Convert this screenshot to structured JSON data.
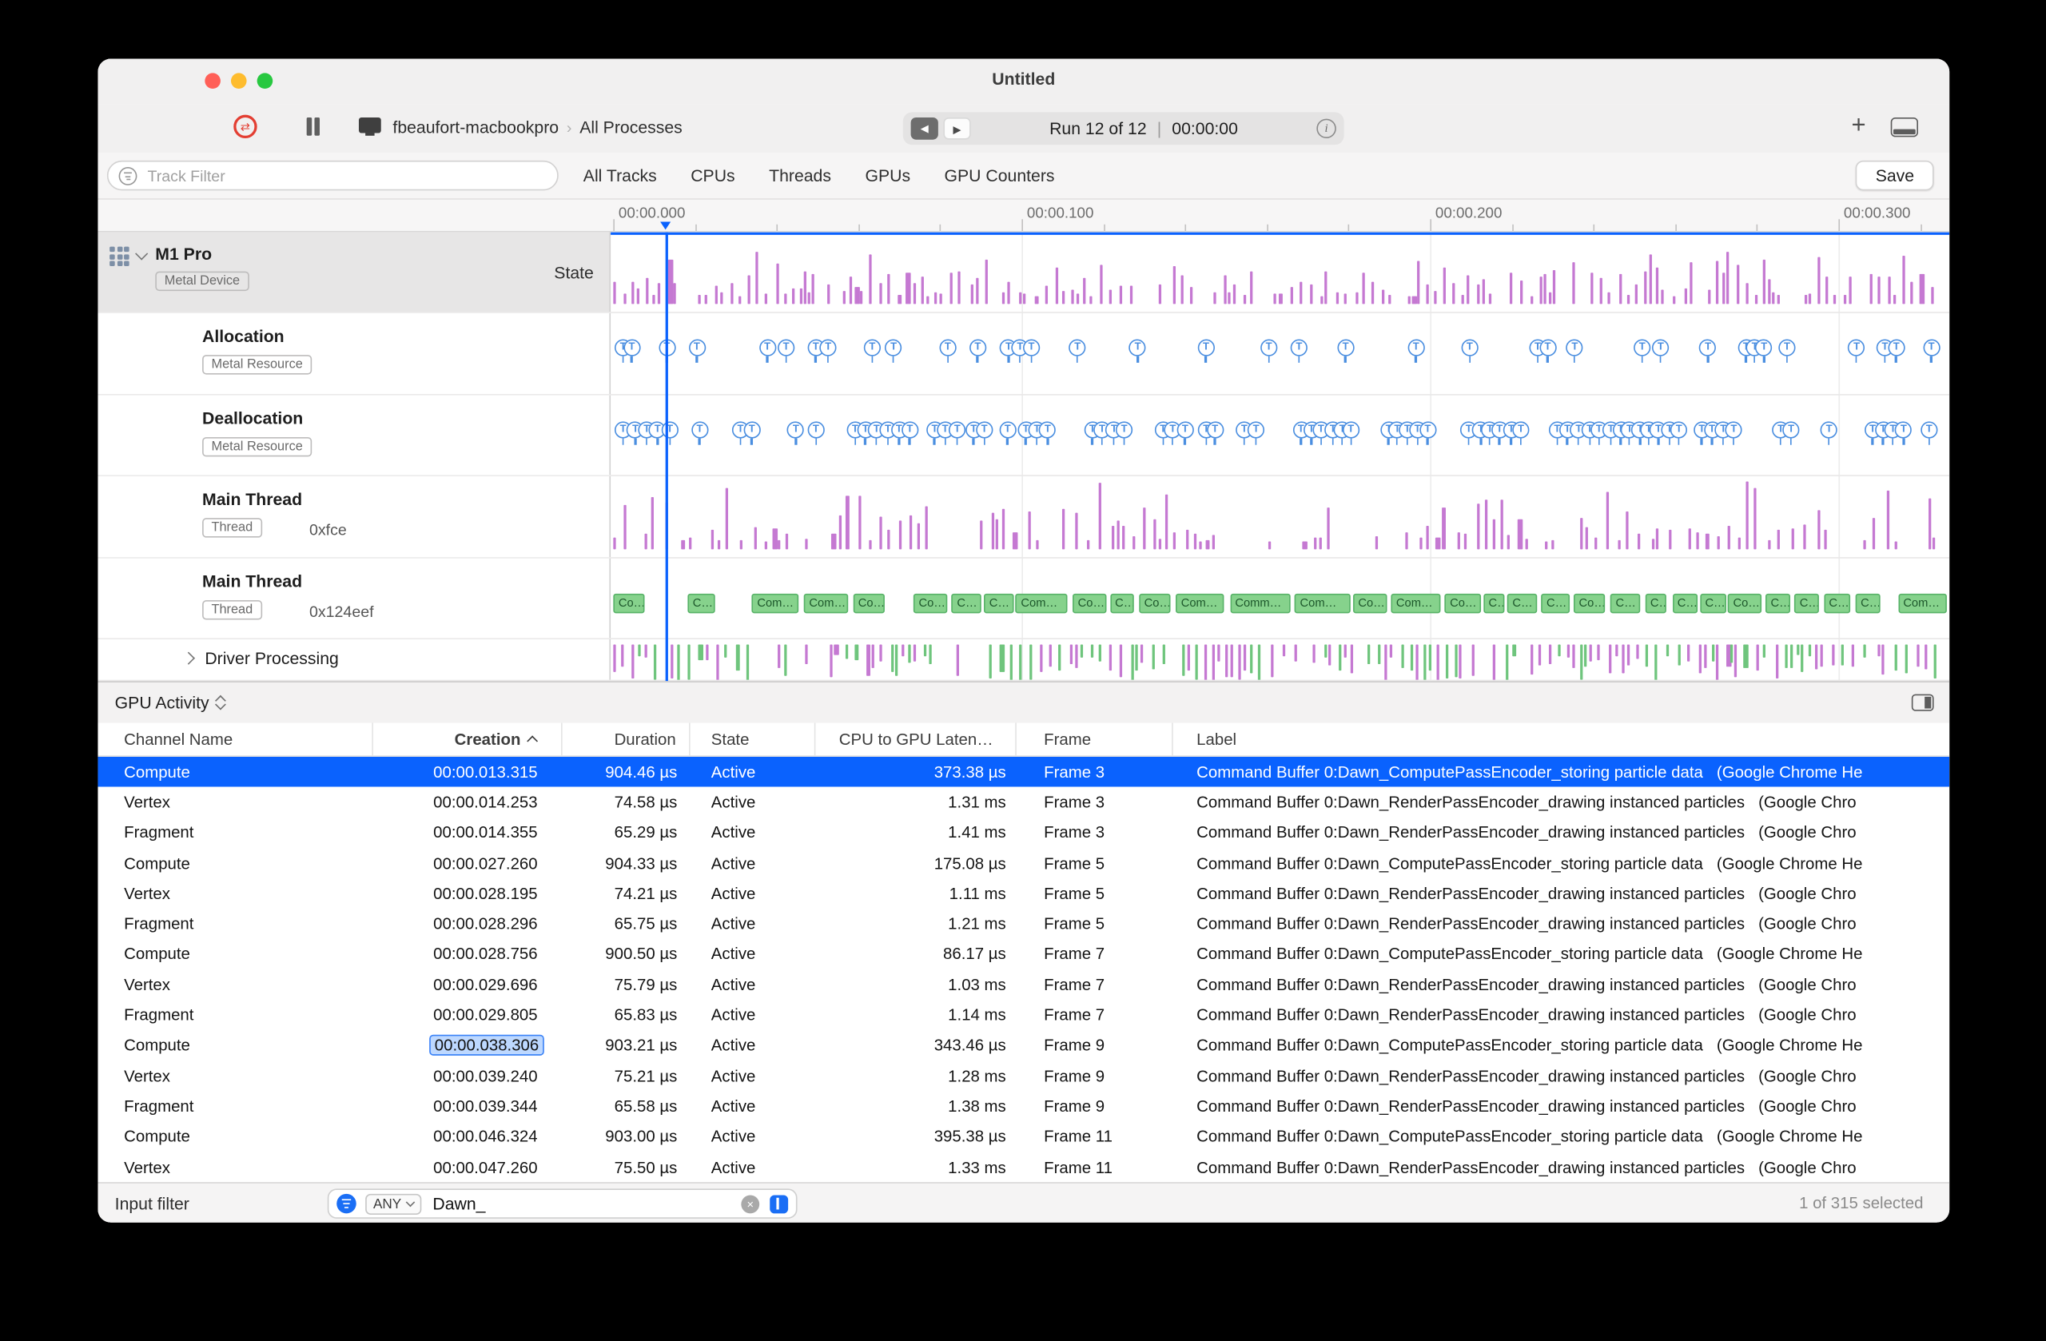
{
  "window": {
    "title": "Untitled"
  },
  "toolbar": {
    "device_name": "fbeaufort-macbookpro",
    "breadcrumb_separator": "›",
    "scope": "All Processes",
    "run_nav": {
      "back_icon": "◀",
      "forward_icon": "▶",
      "run_label": "Run 12 of 12",
      "divider": "|",
      "time": "00:00:00"
    },
    "add_button": "+"
  },
  "filter_bar": {
    "track_filter_placeholder": "Track Filter",
    "tabs": [
      "All Tracks",
      "CPUs",
      "Threads",
      "GPUs",
      "GPU Counters"
    ],
    "save_button": "Save"
  },
  "ruler": {
    "labels": [
      "00:00.000",
      "00:00.100",
      "00:00.200",
      "00:00.300"
    ]
  },
  "tracks": [
    {
      "name": "M1 Pro",
      "tag": "Metal Device",
      "right_label": "State",
      "kind": "purple-bars",
      "level": 0,
      "expanded": true,
      "height": 62,
      "seed": 11
    },
    {
      "name": "Allocation",
      "tag": "Metal Resource",
      "kind": "markers",
      "marker_glyph": "T",
      "level": 1,
      "height": 63,
      "seed": 23,
      "cluster": 0.3,
      "gap_min": 14,
      "gap_var": 42
    },
    {
      "name": "Deallocation",
      "tag": "Metal Resource",
      "kind": "markers",
      "marker_glyph": "T",
      "level": 1,
      "height": 62,
      "seed": 37,
      "cluster": 0.55,
      "gap_min": 9,
      "gap_var": 28
    },
    {
      "name": "Main Thread",
      "tag": "Thread",
      "detail": "0xfce",
      "kind": "purple-bars-2",
      "level": 1,
      "height": 63,
      "seed": 47
    },
    {
      "name": "Main Thread",
      "tag": "Thread",
      "detail": "0x124eef",
      "kind": "green-segments",
      "level": 1,
      "height": 62,
      "seed": 53,
      "segment_labels": {
        "xs": "C…",
        "s": "Co…",
        "m": "Com…",
        "l": "Comm…"
      }
    },
    {
      "name": "Driver Processing",
      "kind": "mixed-bars",
      "level": 1,
      "collapsed": true,
      "height": 32,
      "seed": 67
    }
  ],
  "bottom_pane": {
    "activity_selector": "GPU Activity",
    "columns": [
      {
        "label": "Channel Name"
      },
      {
        "label": "Creation",
        "sorted": "asc"
      },
      {
        "label": "Duration"
      },
      {
        "label": "State"
      },
      {
        "label": "CPU to GPU Laten…"
      },
      {
        "label": "Frame"
      },
      {
        "label": "Label"
      }
    ],
    "rows": [
      {
        "channel": "Compute",
        "creation": "00:00.013.315",
        "duration": "904.46 µs",
        "state": "Active",
        "latency": "373.38 µs",
        "frame": "Frame 3",
        "label": "Command Buffer 0:Dawn_ComputePassEncoder_storing particle data   (Google Chrome He"
      },
      {
        "channel": "Vertex",
        "creation": "00:00.014.253",
        "duration": "74.58 µs",
        "state": "Active",
        "latency": "1.31 ms",
        "frame": "Frame 3",
        "label": "Command Buffer 0:Dawn_RenderPassEncoder_drawing instanced particles   (Google Chro"
      },
      {
        "channel": "Fragment",
        "creation": "00:00.014.355",
        "duration": "65.29 µs",
        "state": "Active",
        "latency": "1.41 ms",
        "frame": "Frame 3",
        "label": "Command Buffer 0:Dawn_RenderPassEncoder_drawing instanced particles   (Google Chro"
      },
      {
        "channel": "Compute",
        "creation": "00:00.027.260",
        "duration": "904.33 µs",
        "state": "Active",
        "latency": "175.08 µs",
        "frame": "Frame 5",
        "label": "Command Buffer 0:Dawn_ComputePassEncoder_storing particle data   (Google Chrome He"
      },
      {
        "channel": "Vertex",
        "creation": "00:00.028.195",
        "duration": "74.21 µs",
        "state": "Active",
        "latency": "1.11 ms",
        "frame": "Frame 5",
        "label": "Command Buffer 0:Dawn_RenderPassEncoder_drawing instanced particles   (Google Chro"
      },
      {
        "channel": "Fragment",
        "creation": "00:00.028.296",
        "duration": "65.75 µs",
        "state": "Active",
        "latency": "1.21 ms",
        "frame": "Frame 5",
        "label": "Command Buffer 0:Dawn_RenderPassEncoder_drawing instanced particles   (Google Chro"
      },
      {
        "channel": "Compute",
        "creation": "00:00.028.756",
        "duration": "900.50 µs",
        "state": "Active",
        "latency": "86.17 µs",
        "frame": "Frame 7",
        "label": "Command Buffer 0:Dawn_ComputePassEncoder_storing particle data   (Google Chrome He"
      },
      {
        "channel": "Vertex",
        "creation": "00:00.029.696",
        "duration": "75.79 µs",
        "state": "Active",
        "latency": "1.03 ms",
        "frame": "Frame 7",
        "label": "Command Buffer 0:Dawn_RenderPassEncoder_drawing instanced particles   (Google Chro"
      },
      {
        "channel": "Fragment",
        "creation": "00:00.029.805",
        "duration": "65.83 µs",
        "state": "Active",
        "latency": "1.14 ms",
        "frame": "Frame 7",
        "label": "Command Buffer 0:Dawn_RenderPassEncoder_drawing instanced particles   (Google Chro"
      },
      {
        "channel": "Compute",
        "creation": "00:00.038.306",
        "duration": "903.21 µs",
        "state": "Active",
        "latency": "343.46 µs",
        "frame": "Frame 9",
        "label": "Command Buffer 0:Dawn_ComputePassEncoder_storing particle data   (Google Chrome He"
      },
      {
        "channel": "Vertex",
        "creation": "00:00.039.240",
        "duration": "75.21 µs",
        "state": "Active",
        "latency": "1.28 ms",
        "frame": "Frame 9",
        "label": "Command Buffer 0:Dawn_RenderPassEncoder_drawing instanced particles   (Google Chro"
      },
      {
        "channel": "Fragment",
        "creation": "00:00.039.344",
        "duration": "65.58 µs",
        "state": "Active",
        "latency": "1.38 ms",
        "frame": "Frame 9",
        "label": "Command Buffer 0:Dawn_RenderPassEncoder_drawing instanced particles   (Google Chro"
      },
      {
        "channel": "Compute",
        "creation": "00:00.046.324",
        "duration": "903.00 µs",
        "state": "Active",
        "latency": "395.38 µs",
        "frame": "Frame 11",
        "label": "Command Buffer 0:Dawn_ComputePassEncoder_storing particle data   (Google Chrome He"
      },
      {
        "channel": "Vertex",
        "creation": "00:00.047.260",
        "duration": "75.50 µs",
        "state": "Active",
        "latency": "1.33 ms",
        "frame": "Frame 11",
        "label": "Command Buffer 0:Dawn_RenderPassEncoder_drawing instanced particles   (Google Chro"
      }
    ],
    "selected_row_index": 0,
    "highlighted_cell": {
      "row": 9,
      "column": "creation"
    },
    "status_bar": {
      "input_filter_label": "Input filter",
      "match_mode": "ANY",
      "filter_value": "Dawn_",
      "selection_summary": "1 of 315 selected"
    }
  },
  "colors": {
    "accent_blue": "#0a62fe",
    "marker_blue": "#4a8ee0",
    "bar_purple": "#c579d2",
    "segment_green": "#86d28c",
    "selection_row": "#0a62fe"
  }
}
